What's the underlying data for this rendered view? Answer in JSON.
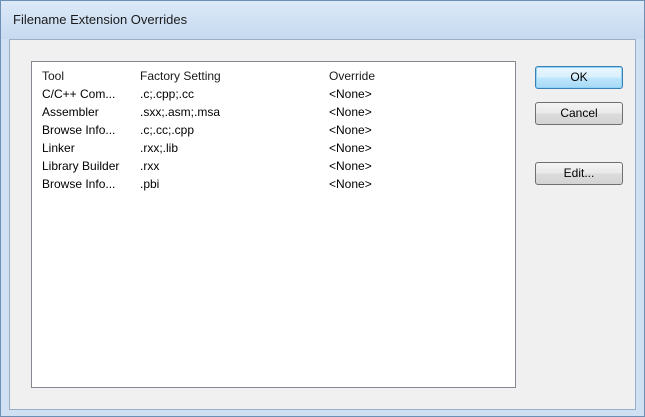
{
  "window": {
    "title": "Filename Extension Overrides"
  },
  "list": {
    "columns": [
      "Tool",
      "Factory Setting",
      "Override"
    ],
    "rows": [
      [
        "C/C++ Com...",
        ".c;.cpp;.cc",
        "<None>"
      ],
      [
        "Assembler",
        ".sxx;.asm;.msa",
        "<None>"
      ],
      [
        "Browse Info...",
        ".c;.cc;.cpp",
        "<None>"
      ],
      [
        "Linker",
        ".rxx;.lib",
        "<None>"
      ],
      [
        "Library Builder",
        ".rxx",
        "<None>"
      ],
      [
        "Browse Info...",
        ".pbi",
        "<None>"
      ]
    ]
  },
  "buttons": {
    "ok": "OK",
    "cancel": "Cancel",
    "edit": "Edit..."
  },
  "colors": {
    "frame": "#cfe0f3",
    "client": "#f0f0f0",
    "default_button_border": "#3c7fb1"
  }
}
